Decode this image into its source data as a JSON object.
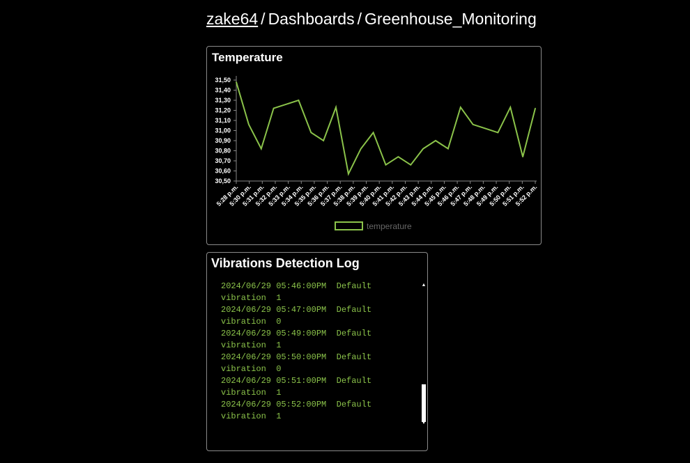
{
  "breadcrumb": {
    "user": "zake64",
    "section": "Dashboards",
    "dashboard": "Greenhouse_Monitoring",
    "separator": "/"
  },
  "temperature_panel": {
    "title": "Temperature"
  },
  "vibration_panel": {
    "title": "Vibrations Detection Log",
    "lines": [
      "vibration  1",
      "2024/06/29 05:46:00PM  Default",
      "vibration  1",
      "2024/06/29 05:47:00PM  Default",
      "vibration  0",
      "2024/06/29 05:49:00PM  Default",
      "vibration  1",
      "2024/06/29 05:50:00PM  Default",
      "vibration  0",
      "2024/06/29 05:51:00PM  Default",
      "vibration  1",
      "2024/06/29 05:52:00PM  Default",
      "vibration  1"
    ]
  },
  "colors": {
    "line": "#8bc34a",
    "background": "#000000",
    "text": "#ffffff",
    "legend_text": "#666666"
  },
  "chart_data": {
    "type": "line",
    "title": "Temperature",
    "x": [
      "5:28 p.m.",
      "5:30 p.m.",
      "5:31 p.m.",
      "5:32 p.m.",
      "5:33 p.m.",
      "5:34 p.m.",
      "5:35 p.m.",
      "5:36 p.m.",
      "5:37 p.m.",
      "5:38 p.m.",
      "5:39 p.m.",
      "5:40 p.m.",
      "5:41 p.m.",
      "5:42 p.m.",
      "5:43 p.m.",
      "5:44 p.m.",
      "5:45 p.m.",
      "5:46 p.m.",
      "5:47 p.m.",
      "5:48 p.m.",
      "5:49 p.m.",
      "5:50 p.m.",
      "5:51 p.m.",
      "5:52 p.m."
    ],
    "series": [
      {
        "name": "temperature",
        "values": [
          31.48,
          31.06,
          30.82,
          31.22,
          31.26,
          31.3,
          30.98,
          30.9,
          31.23,
          30.57,
          30.82,
          30.98,
          30.66,
          30.74,
          30.66,
          30.82,
          30.9,
          30.82,
          31.23,
          31.06,
          31.02,
          30.98,
          31.23,
          30.74,
          31.22
        ]
      }
    ],
    "x_points": [
      "5:28 p.m.",
      "5:30 p.m.",
      "5:31 p.m.",
      "5:32 p.m.",
      "5:33 p.m.",
      "5:33 p.m.",
      "5:34 p.m.",
      "5:35 p.m.",
      "5:36 p.m.",
      "5:37 p.m.",
      "5:38 p.m.",
      "5:39 p.m.",
      "5:40 p.m.",
      "5:41 p.m.",
      "5:42 p.m.",
      "5:43 p.m.",
      "5:44 p.m.",
      "5:45 p.m.",
      "5:46 p.m.",
      "5:47 p.m.",
      "5:48 p.m.",
      "5:49 p.m.",
      "5:50 p.m.",
      "5:51 p.m.",
      "5:52 p.m."
    ],
    "y_ticks": [
      "30,50",
      "30,60",
      "30,70",
      "30,80",
      "30,90",
      "31,00",
      "31,10",
      "31,20",
      "31,30",
      "31,40",
      "31,50"
    ],
    "ylim": [
      30.5,
      31.5
    ],
    "grid": false,
    "legend": "bottom-center"
  }
}
